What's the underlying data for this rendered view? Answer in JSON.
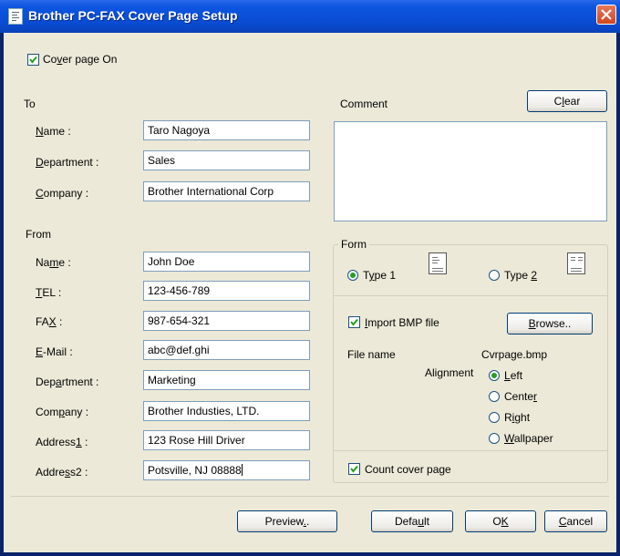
{
  "window": {
    "title": "Brother PC-FAX Cover Page Setup"
  },
  "cover_page_on": {
    "pre": "Co",
    "ul": "v",
    "post": "er page On",
    "checked": true
  },
  "to": {
    "heading": "To",
    "name": {
      "ul": "N",
      "post": "ame :",
      "value": "Taro Nagoya"
    },
    "department": {
      "ul": "D",
      "post": "epartment :",
      "value": "Sales"
    },
    "company": {
      "ul": "C",
      "post": "ompany :",
      "value": "Brother International Corp"
    }
  },
  "from": {
    "heading": "From",
    "name": {
      "pre": "Na",
      "ul": "m",
      "post": "e :",
      "value": "John Doe"
    },
    "tel": {
      "ul": "T",
      "post": "EL :",
      "value": "123-456-789"
    },
    "fax": {
      "pre": "FA",
      "ul": "X",
      "post": " :",
      "value": "987-654-321"
    },
    "email": {
      "ul": "E",
      "post": "-Mail :",
      "value": "abc@def.ghi"
    },
    "department": {
      "pre": "Dep",
      "ul": "a",
      "post": "rtment :",
      "value": "Marketing"
    },
    "company": {
      "pre": "Com",
      "ul": "p",
      "post": "any :",
      "value": "Brother Industies, LTD."
    },
    "address1": {
      "pre": "Address",
      "ul": "1",
      "post": " :",
      "value": "123 Rose Hill Driver"
    },
    "address2": {
      "pre": "Addre",
      "ul": "s",
      "post": "s2 :",
      "value": "Potsville, NJ 08888"
    }
  },
  "comment": {
    "label": "Comment",
    "clear": {
      "pre": "C",
      "ul": "l",
      "post": "ear"
    },
    "value": ""
  },
  "form": {
    "label": "Form",
    "type1": {
      "pre": "T",
      "ul": "y",
      "post": "pe 1",
      "selected": true
    },
    "type2": {
      "pre": "Type ",
      "ul": "2",
      "post": "",
      "selected": false
    },
    "import_bmp": {
      "ul": "I",
      "post": "mport BMP file",
      "checked": true
    },
    "browse": {
      "ul": "B",
      "post": "rowse.."
    },
    "file_name_label": "File name",
    "file_name_value": "Cvrpage.bmp",
    "alignment_label": "Alignment",
    "alignment_options": [
      {
        "pre": "",
        "ul": "L",
        "post": "eft",
        "selected": true
      },
      {
        "pre": "Cente",
        "ul": "r",
        "post": "",
        "selected": false
      },
      {
        "pre": "R",
        "ul": "i",
        "post": "ght",
        "selected": false
      },
      {
        "pre": "",
        "ul": "W",
        "post": "allpaper",
        "selected": false
      }
    ],
    "count_cover_page": {
      "label": "Count cover page",
      "checked": true
    }
  },
  "buttons": {
    "preview": {
      "pre": "Preview",
      "ul": ".",
      "post": "."
    },
    "default": {
      "pre": "Defa",
      "ul": "u",
      "post": "lt"
    },
    "ok": {
      "pre": "O",
      "ul": "K",
      "post": ""
    },
    "cancel": {
      "pre": "",
      "ul": "C",
      "post": "ancel"
    }
  }
}
